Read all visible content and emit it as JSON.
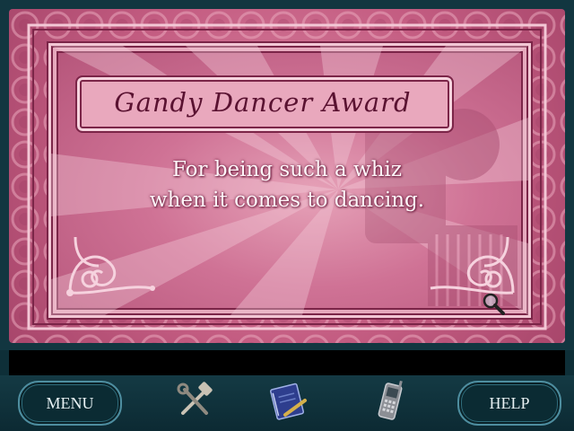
{
  "award": {
    "title": "Gandy Dancer Award",
    "line1": "For being such a whiz",
    "line2": "when it comes to dancing."
  },
  "hud": {
    "menu_label": "MENU",
    "help_label": "HELP",
    "icons": [
      "tools-icon",
      "journal-icon",
      "cellphone-icon"
    ]
  },
  "colors": {
    "certificate_pink": "#c45d82",
    "frame_teal": "#123640",
    "title_text": "#5a1231"
  }
}
